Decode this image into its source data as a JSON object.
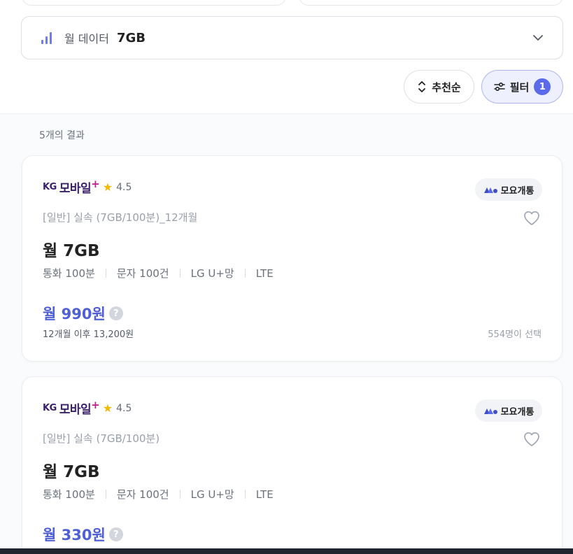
{
  "filters": {
    "data_label": "월 데이터",
    "data_value": "7GB"
  },
  "controls": {
    "sort_label": "추천순",
    "filter_label": "필터",
    "filter_count": "1"
  },
  "results": {
    "count_text": "5개의 결과"
  },
  "plans": [
    {
      "brand_kg": "KG",
      "brand_name": "모바일",
      "brand_plus": "+",
      "rating": "4.5",
      "carrier_badge": "모요개통",
      "plan_name": "[일반] 실속 (7GB/100분)_12개월",
      "title": "월 7GB",
      "specs": [
        "통화 100분",
        "문자 100건",
        "LG U+망",
        "LTE"
      ],
      "price": "월 990원",
      "after_price": "12개월 이후 13,200원",
      "selected_count": "554명이 선택"
    },
    {
      "brand_kg": "KG",
      "brand_name": "모바일",
      "brand_plus": "+",
      "rating": "4.5",
      "carrier_badge": "모요개통",
      "plan_name": "[일반] 실속 (7GB/100분)",
      "title": "월 7GB",
      "specs": [
        "통화 100분",
        "문자 100건",
        "LG U+망",
        "LTE"
      ],
      "price": "월 330원"
    }
  ],
  "colors": {
    "accent": "#5b6ae8",
    "price": "#4f5fd6",
    "brand": "#3a1f6b",
    "brand_plus": "#c2188f",
    "star": "#f5b800"
  },
  "icons": {
    "data": "signal-bars-icon",
    "dropdown": "chevron-down-icon",
    "sort": "sort-arrows-icon",
    "filter": "sliders-icon",
    "rating": "star-icon",
    "carrier": "moyo-logo-icon",
    "favorite": "heart-icon",
    "help": "question-icon"
  }
}
